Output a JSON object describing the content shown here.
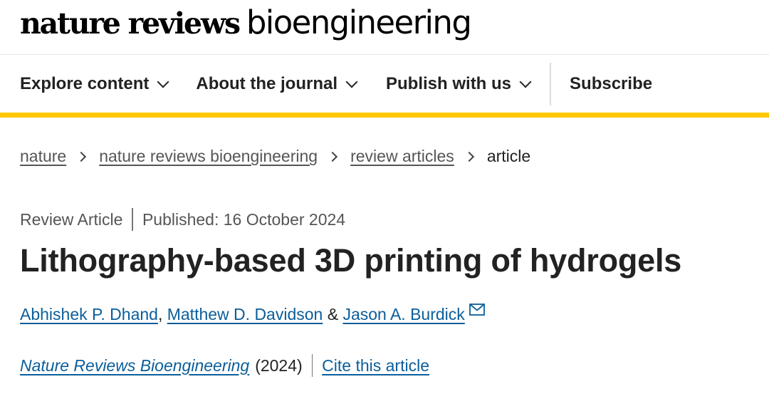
{
  "logo": {
    "bold": "nature reviews",
    "light": "bioengineering"
  },
  "nav": {
    "items": [
      {
        "label": "Explore content",
        "icon": "chevron-down-icon"
      },
      {
        "label": "About the journal",
        "icon": "chevron-down-icon"
      },
      {
        "label": "Publish with us",
        "icon": "chevron-down-icon"
      }
    ],
    "subscribe": "Subscribe",
    "accent_color": "#fdc800"
  },
  "breadcrumb": {
    "items": [
      {
        "label": "nature"
      },
      {
        "label": "nature reviews bioengineering"
      },
      {
        "label": "review articles"
      }
    ],
    "current": "article"
  },
  "article": {
    "type": "Review Article",
    "published": "Published: 16 October 2024",
    "title": "Lithography-based 3D printing of hydrogels",
    "authors": [
      "Abhishek P. Dhand",
      "Matthew D. Davidson",
      "Jason A. Burdick"
    ],
    "author_separators": [
      ", ",
      " & "
    ],
    "journal": "Nature Reviews Bioengineering",
    "year": "(2024)",
    "cite_label": "Cite this article",
    "link_color": "#0b5e9b"
  }
}
